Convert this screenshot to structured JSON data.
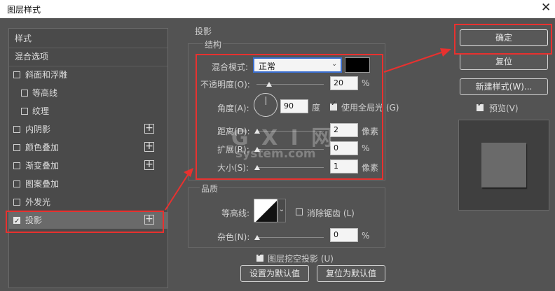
{
  "window": {
    "title": "图层样式",
    "close_glyph": "✕"
  },
  "left_panel": {
    "items": [
      {
        "label": "样式"
      },
      {
        "label": "混合选项"
      },
      {
        "label": "斜面和浮雕"
      },
      {
        "label": "等高线"
      },
      {
        "label": "纹理"
      },
      {
        "label": "内阴影",
        "plus": "+"
      },
      {
        "label": "颜色叠加",
        "plus": "+"
      },
      {
        "label": "渐变叠加",
        "plus": "+"
      },
      {
        "label": "图案叠加"
      },
      {
        "label": "外发光"
      },
      {
        "label": "投影",
        "plus": "+"
      }
    ]
  },
  "section_title": "投影",
  "structure": {
    "title": "结构",
    "blend_mode_label": "混合模式:",
    "blend_mode_value": "正常",
    "blend_color": "#000000",
    "opacity_label": "不透明度(O):",
    "opacity_value": "20",
    "angle_label": "角度(A):",
    "angle_value": "90",
    "angle_unit": "度",
    "global_light_label": "使用全局光 (G)",
    "distance_label": "距离(D):",
    "distance_value": "2",
    "spread_label": "扩展(R):",
    "spread_value": "0",
    "size_label": "大小(S):",
    "size_value": "1",
    "unit_px": "像素",
    "unit_pct": "%"
  },
  "quality": {
    "title": "品质",
    "contour_label": "等高线:",
    "antialias_label": "消除锯齿 (L)",
    "noise_label": "杂色(N):",
    "noise_value": "0",
    "knockout_label": "图层挖空投影 (U)",
    "set_default": "设置为默认值",
    "reset_default": "复位为默认值"
  },
  "right": {
    "ok": "确定",
    "reset": "复位",
    "new_style": "新建样式(W)...",
    "preview_label": "预览(V)"
  },
  "watermark": {
    "line1": "G X I 网",
    "line2": "system.com"
  },
  "colors": {
    "highlight": "#e8312f"
  }
}
